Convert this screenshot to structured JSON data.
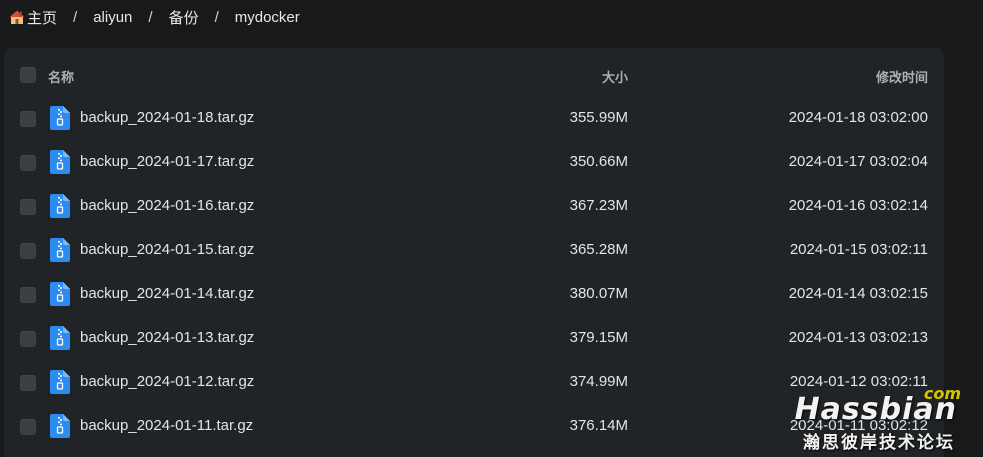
{
  "breadcrumb": {
    "home_icon": "house-icon",
    "items": [
      {
        "label": "主页"
      },
      {
        "label": "aliyun"
      },
      {
        "label": "备份"
      },
      {
        "label": "mydocker"
      }
    ],
    "separator": "/"
  },
  "table": {
    "columns": {
      "name": "名称",
      "size": "大小",
      "modified": "修改时间"
    },
    "file_icon": "zip-archive-icon",
    "icon_color": "#2d8cf0",
    "rows": [
      {
        "name": "backup_2024-01-18.tar.gz",
        "size": "355.99M",
        "modified": "2024-01-18 03:02:00"
      },
      {
        "name": "backup_2024-01-17.tar.gz",
        "size": "350.66M",
        "modified": "2024-01-17 03:02:04"
      },
      {
        "name": "backup_2024-01-16.tar.gz",
        "size": "367.23M",
        "modified": "2024-01-16 03:02:14"
      },
      {
        "name": "backup_2024-01-15.tar.gz",
        "size": "365.28M",
        "modified": "2024-01-15 03:02:11"
      },
      {
        "name": "backup_2024-01-14.tar.gz",
        "size": "380.07M",
        "modified": "2024-01-14 03:02:15"
      },
      {
        "name": "backup_2024-01-13.tar.gz",
        "size": "379.15M",
        "modified": "2024-01-13 03:02:13"
      },
      {
        "name": "backup_2024-01-12.tar.gz",
        "size": "374.99M",
        "modified": "2024-01-12 03:02:11"
      },
      {
        "name": "backup_2024-01-11.tar.gz",
        "size": "376.14M",
        "modified": "2024-01-11 03:02:12"
      }
    ]
  },
  "watermark": {
    "com": "com",
    "brand": "Hassbian",
    "subtitle": "瀚思彼岸技术论坛"
  }
}
